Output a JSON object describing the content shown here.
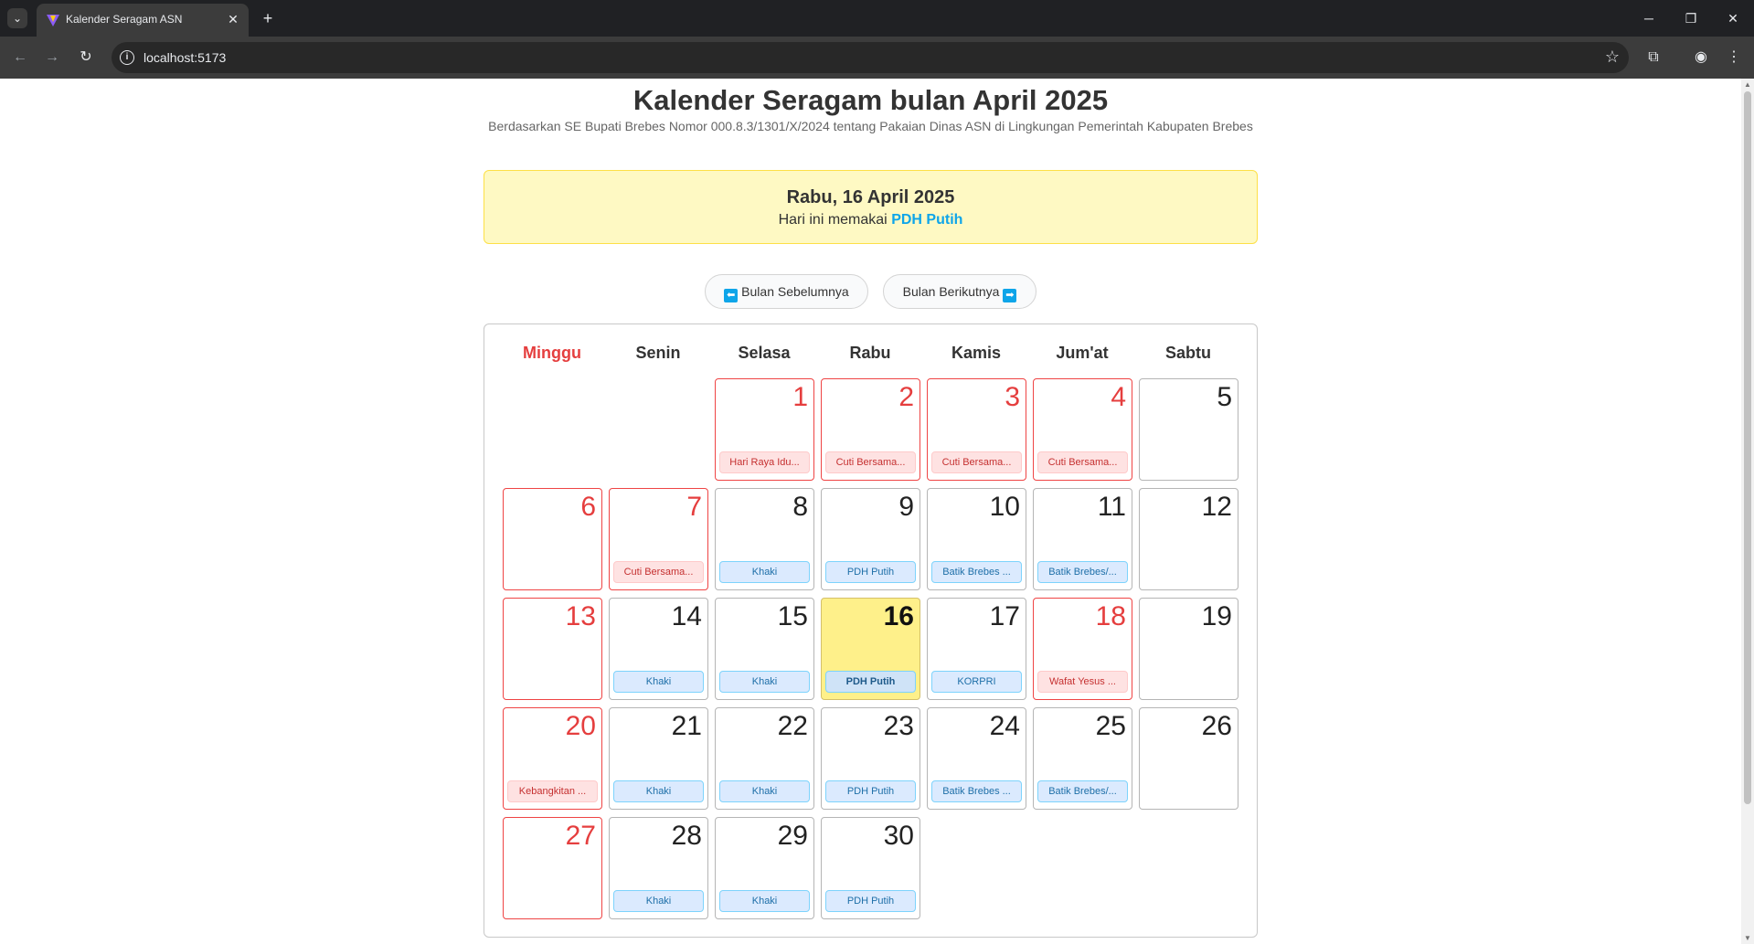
{
  "browser": {
    "tab_title": "Kalender Seragam ASN",
    "url": "localhost:5173"
  },
  "header": {
    "title": "Kalender Seragam bulan April 2025",
    "subtitle": "Berdasarkan SE Bupati Brebes Nomor 000.8.3/1301/X/2024 tentang Pakaian Dinas ASN di Lingkungan Pemerintah Kabupaten Brebes"
  },
  "today": {
    "date": "Rabu, 16 April 2025",
    "prefix": "Hari ini memakai",
    "uniform": "PDH Putih"
  },
  "nav": {
    "prev_label": "Bulan Sebelumnya",
    "next_label": "Bulan Berikutnya"
  },
  "weekdays": [
    "Minggu",
    "Senin",
    "Selasa",
    "Rabu",
    "Kamis",
    "Jum'at",
    "Sabtu"
  ],
  "days": [
    {
      "day": "1",
      "label": "Hari Raya Idu...",
      "holiday": true
    },
    {
      "day": "2",
      "label": "Cuti Bersama...",
      "holiday": true
    },
    {
      "day": "3",
      "label": "Cuti Bersama...",
      "holiday": true
    },
    {
      "day": "4",
      "label": "Cuti Bersama...",
      "holiday": true
    },
    {
      "day": "5",
      "label": "",
      "holiday": false
    },
    {
      "day": "6",
      "label": "",
      "holiday": true
    },
    {
      "day": "7",
      "label": "Cuti Bersama...",
      "holiday": true
    },
    {
      "day": "8",
      "label": "Khaki",
      "holiday": false
    },
    {
      "day": "9",
      "label": "PDH Putih",
      "holiday": false
    },
    {
      "day": "10",
      "label": "Batik Brebes ...",
      "holiday": false
    },
    {
      "day": "11",
      "label": "Batik Brebes/...",
      "holiday": false
    },
    {
      "day": "12",
      "label": "",
      "holiday": false
    },
    {
      "day": "13",
      "label": "",
      "holiday": true
    },
    {
      "day": "14",
      "label": "Khaki",
      "holiday": false
    },
    {
      "day": "15",
      "label": "Khaki",
      "holiday": false
    },
    {
      "day": "16",
      "label": "PDH Putih",
      "holiday": false,
      "today": true
    },
    {
      "day": "17",
      "label": "KORPRI",
      "holiday": false
    },
    {
      "day": "18",
      "label": "Wafat Yesus ...",
      "holiday": true
    },
    {
      "day": "19",
      "label": "",
      "holiday": false
    },
    {
      "day": "20",
      "label": "Kebangkitan ...",
      "holiday": true
    },
    {
      "day": "21",
      "label": "Khaki",
      "holiday": false
    },
    {
      "day": "22",
      "label": "Khaki",
      "holiday": false
    },
    {
      "day": "23",
      "label": "PDH Putih",
      "holiday": false
    },
    {
      "day": "24",
      "label": "Batik Brebes ...",
      "holiday": false
    },
    {
      "day": "25",
      "label": "Batik Brebes/...",
      "holiday": false
    },
    {
      "day": "26",
      "label": "",
      "holiday": false
    },
    {
      "day": "27",
      "label": "",
      "holiday": true
    },
    {
      "day": "28",
      "label": "Khaki",
      "holiday": false
    },
    {
      "day": "29",
      "label": "Khaki",
      "holiday": false
    },
    {
      "day": "30",
      "label": "PDH Putih",
      "holiday": false
    }
  ]
}
